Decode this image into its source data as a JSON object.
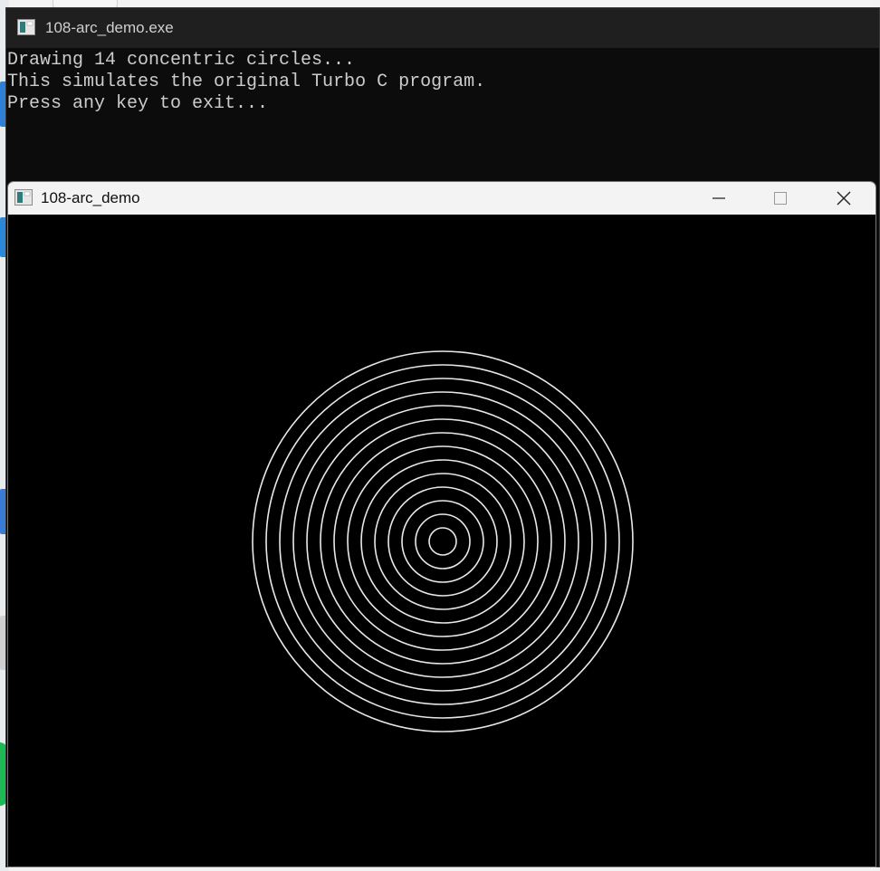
{
  "console": {
    "title": "108-arc_demo.exe",
    "icon": "console-app-icon",
    "lines": [
      "Drawing 14 concentric circles...",
      "This simulates the original Turbo C program.",
      "",
      "Press any key to exit..."
    ]
  },
  "graphics_window": {
    "title": "108-arc_demo",
    "icon": "app-window-icon",
    "controls": {
      "minimize_icon": "minimize-icon",
      "maximize_icon": "maximize-icon",
      "close_icon": "close-icon"
    },
    "circles": {
      "count": 14,
      "stroke_color": "#e8e8e8",
      "background_color": "#000000"
    }
  }
}
